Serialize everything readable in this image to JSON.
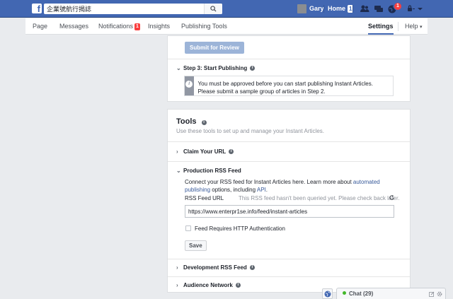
{
  "topbar": {
    "logo_letter": "f",
    "search_value": "企業號航行揭誌",
    "user_name": "Gary",
    "home_label": "Home",
    "home_badge": "1",
    "notification_count": "1"
  },
  "pagenav": {
    "tabs": [
      {
        "label": "Page"
      },
      {
        "label": "Messages"
      },
      {
        "label": "Notifications",
        "badge": "1"
      },
      {
        "label": "Insights"
      },
      {
        "label": "Publishing Tools"
      }
    ],
    "settings_label": "Settings",
    "help_label": "Help",
    "help_caret": "▾"
  },
  "step_card": {
    "submit_button": "Submit for Review",
    "step3_title": "Step 3: Start Publishing",
    "notice_text": "You must be approved before you can start publishing Instant Articles. Please submit a sample group of articles in Step 2."
  },
  "tools": {
    "title": "Tools",
    "subtitle": "Use these tools to set up and manage your Instant Articles.",
    "claim_url": "Claim Your URL",
    "production_rss": "Production RSS Feed",
    "rss_desc_part1": "Connect your RSS feed for Instant Articles here. Learn more about ",
    "rss_desc_link1": "automated publishing",
    "rss_desc_part2": " options, including ",
    "rss_desc_link2": "API",
    "rss_desc_part3": ".",
    "rss_feed_url_label": "RSS Feed URL",
    "rss_status": "This RSS feed hasn't been queried yet. Please check back later.",
    "rss_url_value": "https://www.enterpr1se.info/feed/instant-articles",
    "http_auth_label": "Feed Requires HTTP Authentication",
    "http_auth_checked": false,
    "save_button": "Save",
    "development_rss": "Development RSS Feed",
    "audience_network": "Audience Network"
  },
  "chat": {
    "label": "Chat (29)"
  },
  "colors": {
    "brand": "#4267b2",
    "link": "#365899",
    "badge": "#fa3e3e",
    "online": "#42b72a"
  }
}
